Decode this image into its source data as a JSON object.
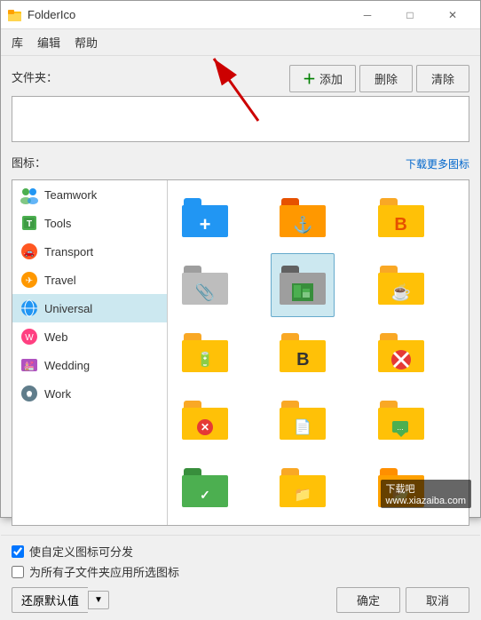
{
  "window": {
    "title": "FolderIco",
    "controls": {
      "minimize": "─",
      "maximize": "□",
      "close": "✕"
    }
  },
  "menu": {
    "items": [
      "库",
      "编辑",
      "帮助"
    ]
  },
  "folder_section": {
    "label": "文件夹：",
    "buttons": {
      "add": "添加",
      "delete": "删除",
      "clear": "清除"
    }
  },
  "icon_section": {
    "label": "图标：",
    "download_link": "下载更多图标",
    "categories": [
      {
        "id": "teamwork",
        "label": "Teamwork",
        "icon": "🤝"
      },
      {
        "id": "tools",
        "label": "Tools",
        "icon": "🔧"
      },
      {
        "id": "transport",
        "label": "Transport",
        "icon": "🚗"
      },
      {
        "id": "travel",
        "label": "Travel",
        "icon": "✈"
      },
      {
        "id": "universal",
        "label": "Universal",
        "icon": "🌐"
      },
      {
        "id": "web",
        "label": "Web",
        "icon": "🌍"
      },
      {
        "id": "wedding",
        "label": "Wedding",
        "icon": "💒"
      },
      {
        "id": "work",
        "label": "Work",
        "icon": "⚙"
      }
    ]
  },
  "icon_grid": {
    "items": [
      {
        "symbol": "+",
        "color": "#2196F3",
        "overlay_color": "#fff"
      },
      {
        "symbol": "⚓",
        "color": "#E65100",
        "overlay_color": "#fff"
      },
      {
        "symbol": "B",
        "color": "#F57F17",
        "overlay_color": "#fff"
      },
      {
        "symbol": "📎",
        "color": "#9E9E9E",
        "overlay_color": "#fff"
      },
      {
        "symbol": "📊",
        "color": "#388E3C",
        "overlay_color": "#fff"
      },
      {
        "symbol": "☕",
        "color": "#F9A825",
        "overlay_color": "#fff"
      },
      {
        "symbol": "🔋",
        "color": "#F57F17",
        "overlay_color": "#fff"
      },
      {
        "symbol": "B",
        "color": "#FFC107",
        "overlay_color": "#333"
      },
      {
        "symbol": "🚫",
        "color": "#E53935",
        "overlay_color": "#fff"
      },
      {
        "symbol": "✕",
        "color": "#E53935",
        "overlay_color": "#fff"
      },
      {
        "symbol": "📄",
        "color": "#FFC107",
        "overlay_color": "#fff"
      },
      {
        "symbol": "💬",
        "color": "#4CAF50",
        "overlay_color": "#fff"
      },
      {
        "symbol": "✓",
        "color": "#4CAF50",
        "overlay_color": "#fff"
      },
      {
        "symbol": "📁",
        "color": "#FFC107",
        "overlay_color": "#fff"
      },
      {
        "symbol": "📂",
        "color": "#FF8F00",
        "overlay_color": "#fff"
      }
    ]
  },
  "bottom": {
    "checkbox1": "使自定义图标可分发",
    "checkbox2": "为所有子文件夹应用所选图标",
    "checkbox1_checked": true,
    "checkbox2_checked": false,
    "reset_btn": "还原默认值",
    "ok_btn": "确定",
    "cancel_btn": "取消"
  },
  "watermark": "下载吧\nwww.xiazaiba.com"
}
